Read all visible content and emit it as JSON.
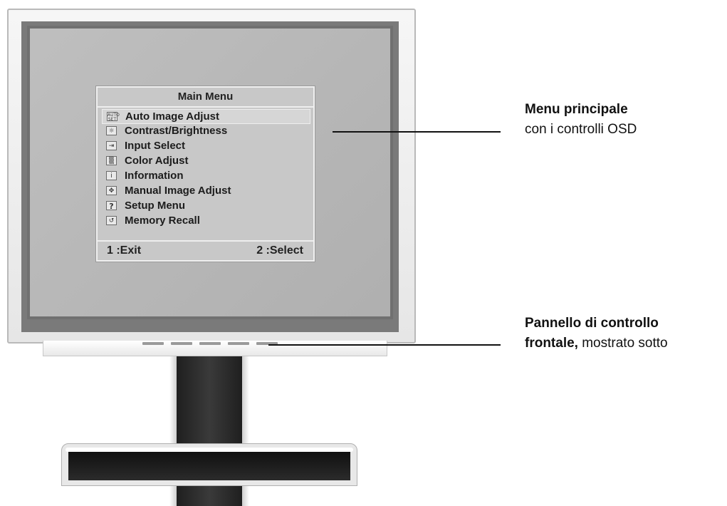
{
  "osd": {
    "title": "Main Menu",
    "items": [
      {
        "label": "Auto Image Adjust",
        "icon": "auto-set-icon",
        "glyph": "AUTO SET",
        "selected": true
      },
      {
        "label": "Contrast/Brightness",
        "icon": "brightness-icon",
        "glyph": "☼",
        "selected": false
      },
      {
        "label": "Input Select",
        "icon": "input-select-icon",
        "glyph": "⇥",
        "selected": false
      },
      {
        "label": "Color Adjust",
        "icon": "color-adjust-icon",
        "glyph": "▒",
        "selected": false
      },
      {
        "label": "Information",
        "icon": "information-icon",
        "glyph": "i",
        "selected": false
      },
      {
        "label": "Manual Image Adjust",
        "icon": "manual-adjust-icon",
        "glyph": "✥",
        "selected": false
      },
      {
        "label": "Setup Menu",
        "icon": "setup-menu-icon",
        "glyph": "?",
        "selected": false
      },
      {
        "label": "Memory Recall",
        "icon": "memory-recall-icon",
        "glyph": "↺",
        "selected": false
      }
    ],
    "footer_left": "1 :Exit",
    "footer_right": "2 :Select"
  },
  "callouts": {
    "main_menu_title": "Menu principale",
    "main_menu_text": "con i controlli OSD",
    "panel_title": "Pannello di controllo",
    "panel_bold": "frontale,",
    "panel_text": " mostrato sotto"
  }
}
